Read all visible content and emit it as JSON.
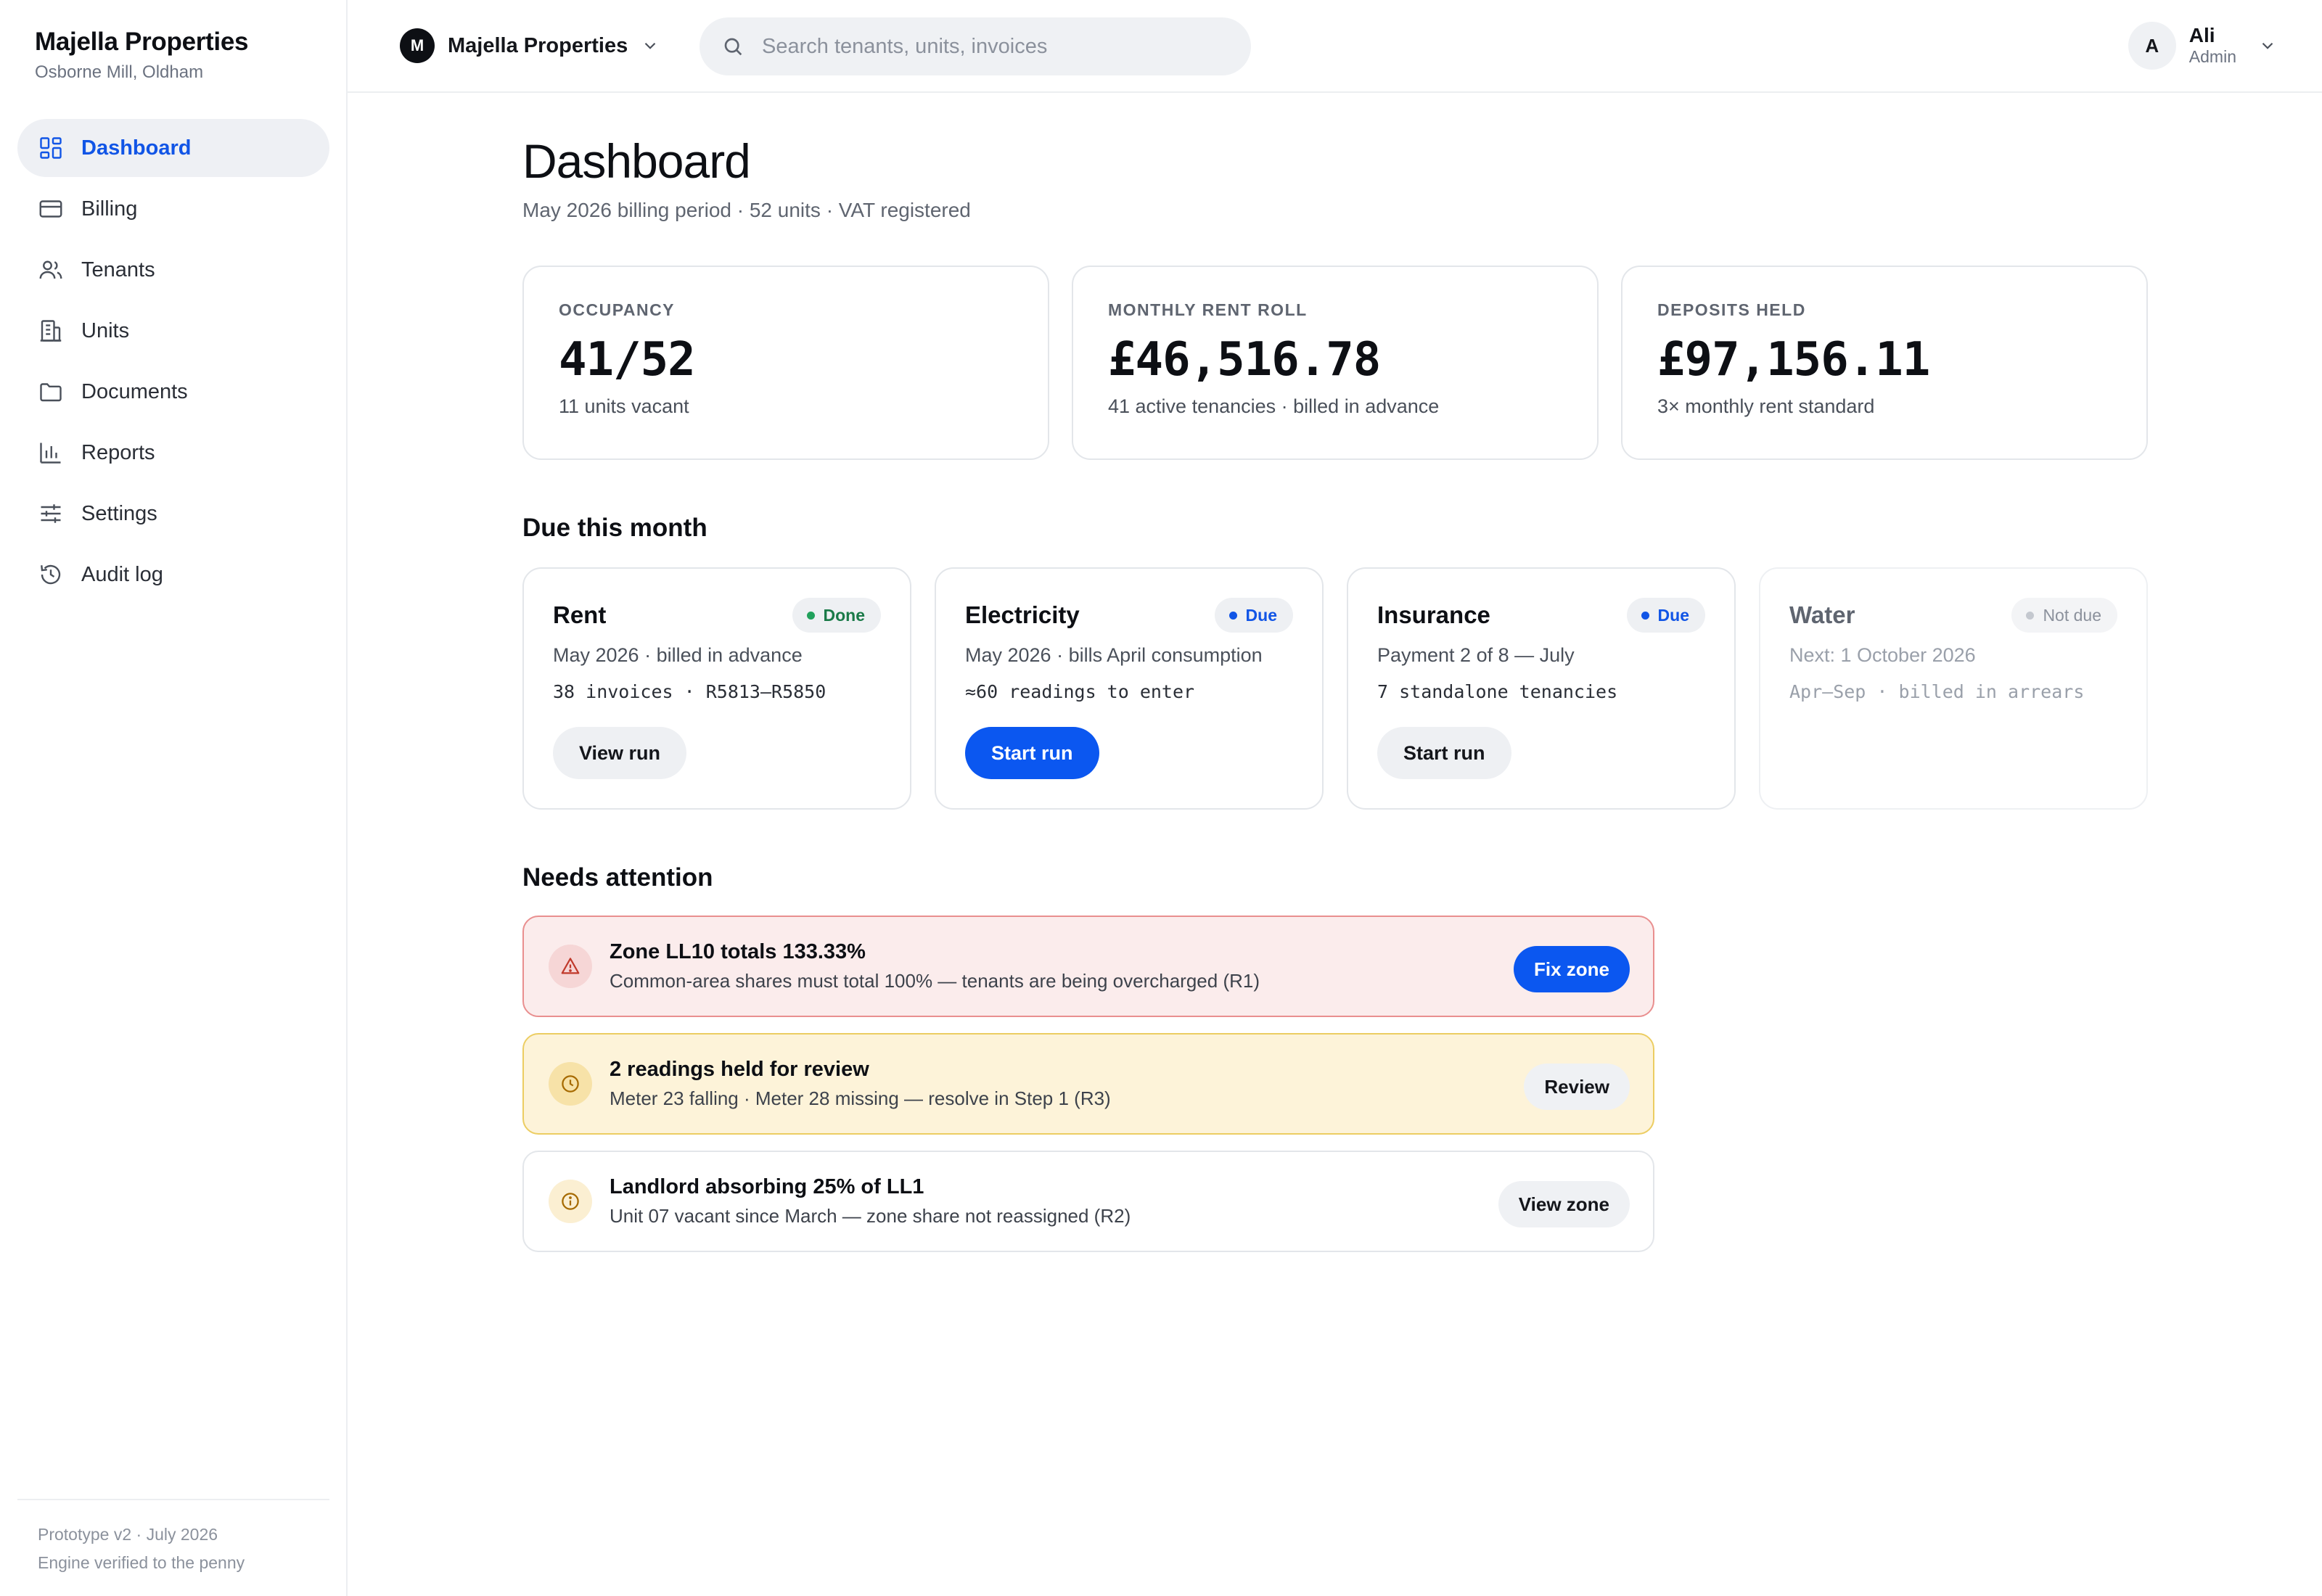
{
  "app": {
    "brand_name": "Majella Properties",
    "brand_location": "Osborne Mill, Oldham"
  },
  "sidebar": {
    "items": [
      {
        "label": "Dashboard",
        "icon": "dashboard-icon",
        "active": true
      },
      {
        "label": "Billing",
        "icon": "credit-card-icon",
        "active": false
      },
      {
        "label": "Tenants",
        "icon": "users-icon",
        "active": false
      },
      {
        "label": "Units",
        "icon": "building-icon",
        "active": false
      },
      {
        "label": "Documents",
        "icon": "folder-icon",
        "active": false
      },
      {
        "label": "Reports",
        "icon": "bar-chart-icon",
        "active": false
      },
      {
        "label": "Settings",
        "icon": "sliders-icon",
        "active": false
      },
      {
        "label": "Audit log",
        "icon": "history-icon",
        "active": false
      }
    ],
    "footer_line1": "Prototype v2 · July 2026",
    "footer_line2": "Engine verified to the penny"
  },
  "topbar": {
    "org_initial": "M",
    "org_name": "Majella Properties",
    "search_placeholder": "Search tenants, units, invoices",
    "search_value": "",
    "user_initial": "A",
    "user_name": "Ali",
    "user_role": "Admin"
  },
  "page": {
    "title": "Dashboard",
    "subtitle": "May 2026 billing period · 52 units · VAT registered"
  },
  "stats": [
    {
      "label": "OCCUPANCY",
      "value": "41/52",
      "note": "11 units vacant"
    },
    {
      "label": "MONTHLY RENT ROLL",
      "value": "£46,516.78",
      "note": "41 active tenancies · billed in advance"
    },
    {
      "label": "DEPOSITS HELD",
      "value": "£97,156.11",
      "note": "3× monthly rent standard"
    }
  ],
  "due_section": {
    "title": "Due this month",
    "cards": [
      {
        "title": "Rent",
        "status": "Done",
        "line": "May 2026 · billed in advance",
        "mono": "38 invoices · R5813–R5850",
        "button": "View run"
      },
      {
        "title": "Electricity",
        "status": "Due",
        "line": "May 2026 · bills April consumption",
        "mono": "≈60 readings to enter",
        "button": "Start run"
      },
      {
        "title": "Insurance",
        "status": "Due",
        "line": "Payment 2 of 8 — July",
        "mono": "7 standalone tenancies",
        "button": "Start run"
      },
      {
        "title": "Water",
        "status": "Not due",
        "line": "Next: 1 October 2026",
        "mono": "Apr–Sep · billed in arrears",
        "button": ""
      }
    ]
  },
  "attention": {
    "title": "Needs attention",
    "items": [
      {
        "severity": "error",
        "icon": "warning-icon",
        "title": "Zone LL10 totals 133.33%",
        "desc": "Common-area shares must total 100% — tenants are being overcharged (R1)",
        "button": "Fix zone"
      },
      {
        "severity": "warning",
        "icon": "clock-icon",
        "title": "2 readings held for review",
        "desc": "Meter 23 falling · Meter 28 missing — resolve in Step 1 (R3)",
        "button": "Review"
      },
      {
        "severity": "info",
        "icon": "info-icon",
        "title": "Landlord absorbing 25% of LL1",
        "desc": "Unit 07 vacant since March — zone share not reassigned (R2)",
        "button": "View zone"
      }
    ]
  },
  "colors": {
    "accent": "#0b57f0",
    "active_nav_text": "#1155e6",
    "done_green": "#21a15c",
    "error_bg": "#fbecec",
    "warning_bg": "#fdf3d9"
  }
}
